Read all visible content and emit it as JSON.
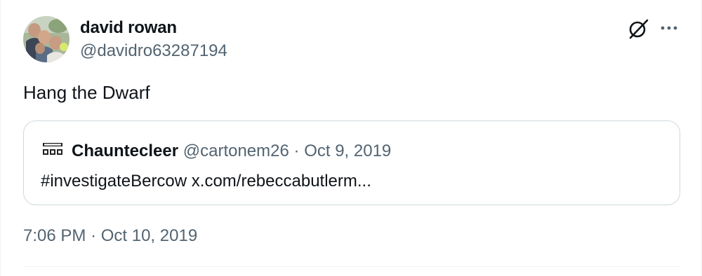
{
  "tweet": {
    "author": {
      "name": "david rowan",
      "handle": "@davidro63287194",
      "avatar_icon": "profile-photo-group"
    },
    "text": "Hang the Dwarf",
    "quoted": {
      "avatar_icon": "defund-the-bbc-logo",
      "name": "Chauntecleer",
      "handle": "@cartonem26",
      "separator": "·",
      "date": "Oct 9, 2019",
      "text": "#investigateBercow x.com/rebeccabutlerm..."
    },
    "timestamp": {
      "time": "7:06 PM",
      "separator": "·",
      "date": "Oct 10, 2019"
    },
    "actions": {
      "grok_icon": "grok-icon",
      "more_icon": "more-icon"
    }
  },
  "colors": {
    "text_primary": "#0f1419",
    "text_secondary": "#536471",
    "border": "#cfd9de",
    "divider": "#eff3f4",
    "background": "#ffffff"
  }
}
